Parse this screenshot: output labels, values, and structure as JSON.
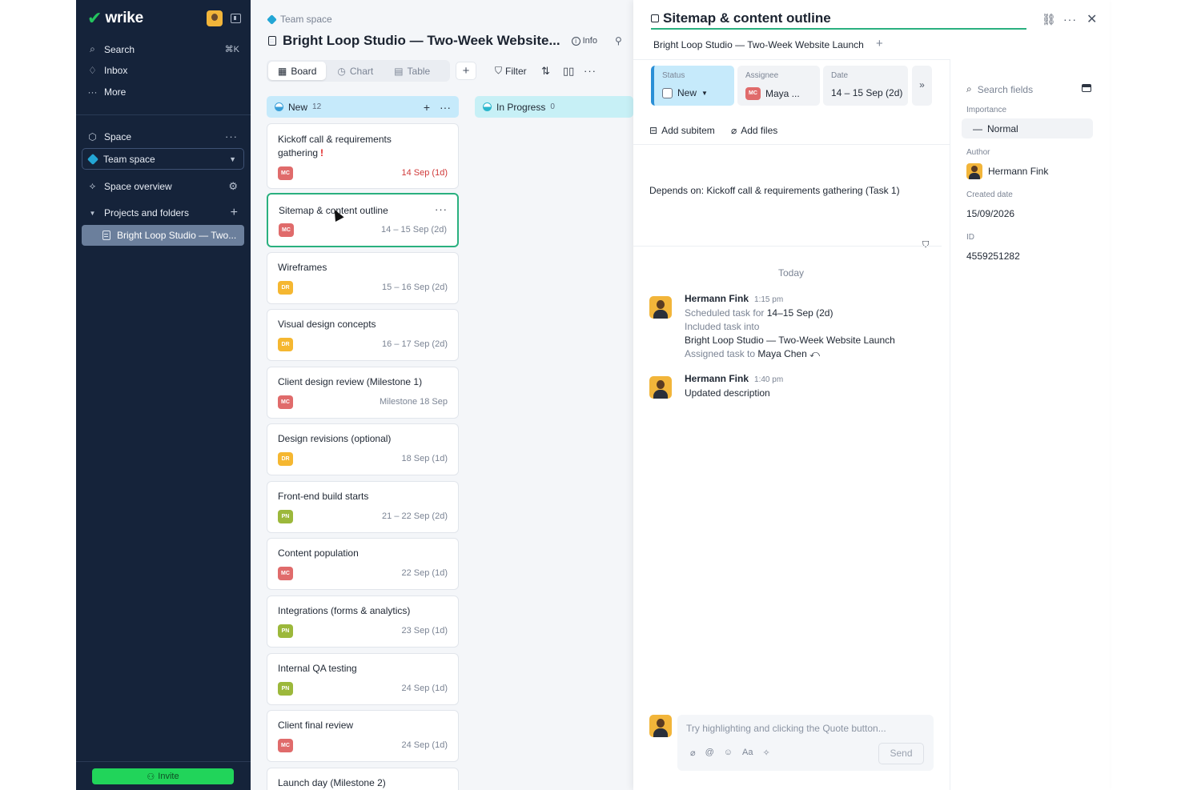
{
  "sidebar": {
    "logo": "wrike",
    "search": "Search",
    "search_shortcut": "⌘K",
    "inbox": "Inbox",
    "more": "More",
    "space_label": "Space",
    "team_space": "Team space",
    "space_overview": "Space overview",
    "projects_and_folders": "Projects and folders",
    "active_project": "Bright Loop Studio — Two...",
    "invite": "Invite"
  },
  "main": {
    "breadcrumb": "Team space",
    "project_title": "Bright Loop Studio — Two-Week Website...",
    "info": "Info",
    "views": [
      {
        "label": "Board",
        "icon": "board-icon"
      },
      {
        "label": "Chart",
        "icon": "chart-icon"
      },
      {
        "label": "Table",
        "icon": "table-icon"
      }
    ],
    "filter": "Filter",
    "columns": [
      {
        "name": "New",
        "count": "12",
        "color": "#c6eafb"
      },
      {
        "name": "In Progress",
        "count": "0",
        "color": "#c7f0f6"
      }
    ],
    "cards": [
      {
        "title": "Kickoff call & requirements gathering",
        "badge": "MC",
        "badge_color": "#e06b6b",
        "date": "14 Sep (1d)",
        "urgent": "!"
      },
      {
        "title": "Sitemap & content outline",
        "badge": "MC",
        "badge_color": "#e06b6b",
        "date": "14 – 15 Sep (2d)"
      },
      {
        "title": "Wireframes",
        "badge": "DR",
        "badge_color": "#f5b731",
        "date": "15 – 16 Sep (2d)"
      },
      {
        "title": "Visual design concepts",
        "badge": "DR",
        "badge_color": "#f5b731",
        "date": "16 – 17 Sep (2d)"
      },
      {
        "title": "Client design review (Milestone 1)",
        "badge": "MC",
        "badge_color": "#e06b6b",
        "date": "Milestone 18 Sep"
      },
      {
        "title": "Design revisions (optional)",
        "badge": "DR",
        "badge_color": "#f5b731",
        "date": "18 Sep (1d)"
      },
      {
        "title": "Front-end build starts",
        "badge": "PN",
        "badge_color": "#9cb83b",
        "date": "21 – 22 Sep (2d)"
      },
      {
        "title": "Content population",
        "badge": "MC",
        "badge_color": "#e06b6b",
        "date": "22 Sep (1d)"
      },
      {
        "title": "Integrations (forms & analytics)",
        "badge": "PN",
        "badge_color": "#9cb83b",
        "date": "23 Sep (1d)"
      },
      {
        "title": "Internal QA testing",
        "badge": "PN",
        "badge_color": "#9cb83b",
        "date": "24 Sep (1d)"
      },
      {
        "title": "Client final review",
        "badge": "MC",
        "badge_color": "#e06b6b",
        "date": "24 Sep (1d)"
      },
      {
        "title": "Launch day (Milestone 2)",
        "badge": "",
        "badge_color": "",
        "date": ""
      }
    ]
  },
  "panel": {
    "task_title": "Sitemap & content outline",
    "project": "Bright Loop Studio — Two-Week Website Launch",
    "status_label": "Status",
    "status_value": "New",
    "assignee_label": "Assignee",
    "assignee_badge": "MC",
    "assignee_value": "Maya ...",
    "date_label": "Date",
    "date_value": "14 – 15 Sep (2d)",
    "add_subitem": "Add subitem",
    "add_files": "Add files",
    "depends_on": "Depends on: Kickoff call & requirements gathering (Task 1)",
    "today": "Today",
    "activity": [
      {
        "name": "Hermann Fink",
        "time": "1:15 pm",
        "scheduled_prefix": "Scheduled task for",
        "scheduled_value": "14–15 Sep (2d)",
        "included": "Included task into",
        "included_project": "Bright Loop Studio — Two-Week Website Launch",
        "assigned_prefix": "Assigned task to",
        "assigned_value": "Maya Chen"
      },
      {
        "name": "Hermann Fink",
        "time": "1:40 pm",
        "text": "Updated description"
      }
    ],
    "comment_placeholder": "Try highlighting and clicking the Quote button...",
    "send": "Send",
    "fields": {
      "search_placeholder": "Search fields",
      "importance_label": "Importance",
      "importance_value": "Normal",
      "author_label": "Author",
      "author_value": "Hermann Fink",
      "created_label": "Created date",
      "created_value": "15/09/2026",
      "id_label": "ID",
      "id_value": "4559251282"
    }
  },
  "colors": {
    "sidebar_bg": "#15233a",
    "brand_green": "#24c45e",
    "selected_border": "#2ab07f",
    "status_blue": "#2b8fd6"
  }
}
